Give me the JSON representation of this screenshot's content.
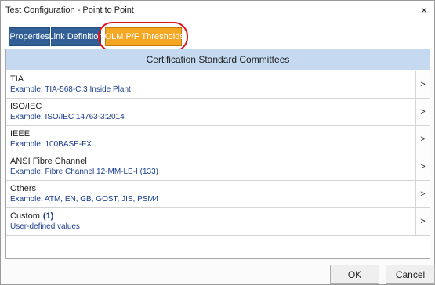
{
  "window": {
    "title": "Test Configuration - Point to Point",
    "close_glyph": "×",
    "close_icon": "close-icon"
  },
  "tabs": [
    {
      "label": "Properties",
      "active": false
    },
    {
      "label": "Link Definition",
      "active": false
    },
    {
      "label": "iOLM P/F Thresholds",
      "active": true
    }
  ],
  "panel": {
    "header": "Certification Standard Committees",
    "rows": [
      {
        "name": "TIA",
        "count": "",
        "example": "Example: TIA-568-C.3 Inside Plant",
        "chevron": ">"
      },
      {
        "name": "ISO/IEC",
        "count": "",
        "example": "Example: ISO/IEC 14763-3:2014",
        "chevron": ">"
      },
      {
        "name": "IEEE",
        "count": "",
        "example": "Example: 100BASE-FX",
        "chevron": ">"
      },
      {
        "name": "ANSI Fibre Channel",
        "count": "",
        "example": "Example: Fibre Channel 12-MM-LE-I (133)",
        "chevron": ">"
      },
      {
        "name": "Others",
        "count": "",
        "example": "Example: ATM, EN, GB, GOST, JIS, PSM4",
        "chevron": ">"
      },
      {
        "name": "Custom",
        "count": "(1)",
        "example": "User-defined values",
        "chevron": ">"
      }
    ]
  },
  "footer": {
    "ok_label": "OK",
    "cancel_label": "Cancel"
  },
  "colors": {
    "tab_normal": "#315f96",
    "tab_active": "#f5a623",
    "highlight_ring": "#e0141a",
    "panel_header": "#c5d9f1",
    "example_text": "#1a3d8f"
  }
}
